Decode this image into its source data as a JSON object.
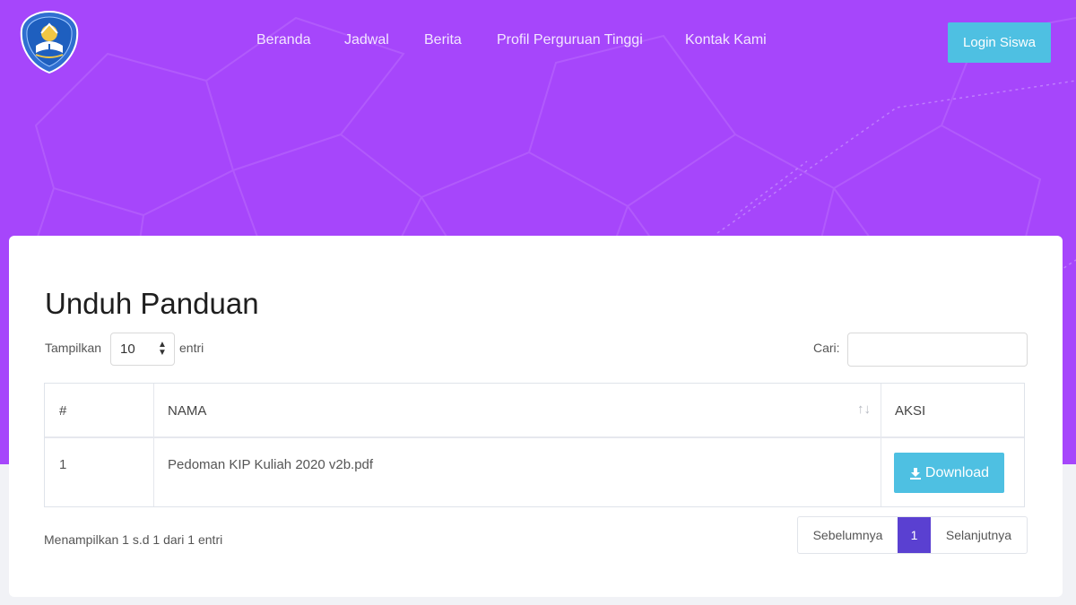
{
  "navbar": {
    "logo_icon": "tut-wuri-handayani-logo",
    "links": [
      "Beranda",
      "Jadwal",
      "Berita",
      "Profil Perguruan Tinggi",
      "Kontak Kami"
    ],
    "login_label": "Login Siswa"
  },
  "colors": {
    "hero_background": "#a646fb",
    "accent_button": "#4ec0e2",
    "active_page": "#5a40d1"
  },
  "main": {
    "title": "Unduh Panduan",
    "length": {
      "prefix": "Tampilkan",
      "value": "10",
      "suffix": "entri"
    },
    "search": {
      "label": "Cari:",
      "value": ""
    },
    "table": {
      "headers": [
        "#",
        "NAMA",
        "AKSI"
      ],
      "sort_icon": "sort-ascending-icon",
      "rows": [
        {
          "no": "1",
          "name": "Pedoman KIP Kuliah 2020 v2b.pdf",
          "action": "Download",
          "action_icon": "download-icon"
        }
      ]
    },
    "info": "Menampilkan 1 s.d 1 dari 1 entri",
    "pagination": {
      "prev": "Sebelumnya",
      "current": "1",
      "next": "Selanjutnya"
    }
  }
}
